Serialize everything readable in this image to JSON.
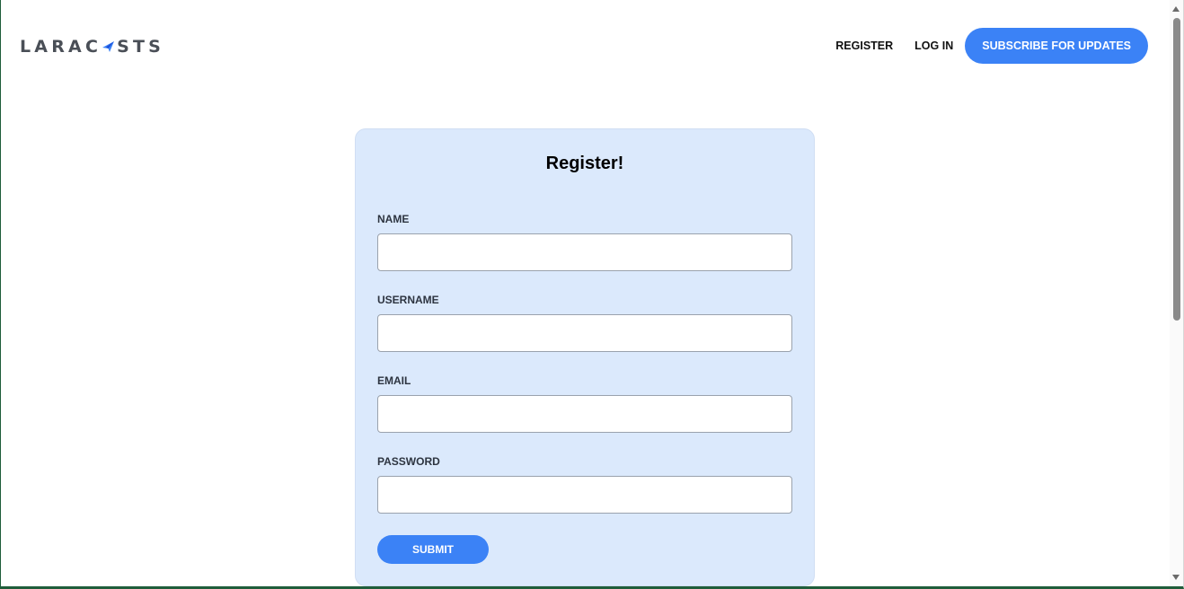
{
  "header": {
    "logo_text_before": "LARAC",
    "logo_text_after": "STS",
    "logo_icon": "paper-plane-icon",
    "nav": {
      "register_label": "REGISTER",
      "login_label": "LOG IN",
      "subscribe_label": "SUBSCRIBE FOR UPDATES"
    }
  },
  "form": {
    "title": "Register!",
    "fields": [
      {
        "label": "NAME",
        "value": "",
        "type": "text"
      },
      {
        "label": "USERNAME",
        "value": "",
        "type": "text"
      },
      {
        "label": "EMAIL",
        "value": "",
        "type": "email"
      },
      {
        "label": "PASSWORD",
        "value": "",
        "type": "password"
      }
    ],
    "submit_label": "SUBMIT"
  },
  "colors": {
    "accent": "#3b82f6",
    "card_background": "#dbe9fc",
    "logo_icon": "#3b82f6",
    "logo_text": "#4a4f57"
  }
}
